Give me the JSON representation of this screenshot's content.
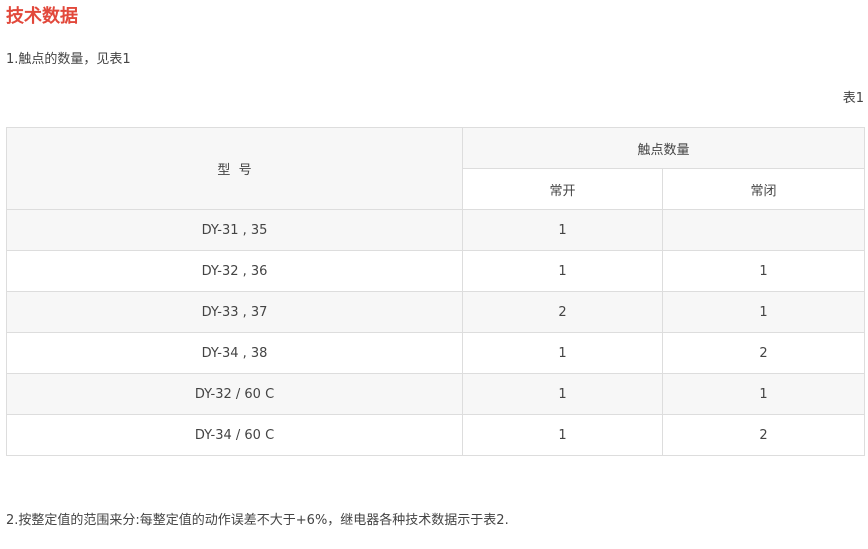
{
  "heading": "技术数据",
  "intro": "1.触点的数量，见表1",
  "table_caption": "表1",
  "table": {
    "header_model": "型  号",
    "header_group": "触点数量",
    "header_no": "常开",
    "header_nc": "常闭",
    "rows": [
      {
        "model": "DY-31 , 35",
        "no": "1",
        "nc": ""
      },
      {
        "model": "DY-32 , 36",
        "no": "1",
        "nc": "1"
      },
      {
        "model": "DY-33 , 37",
        "no": "2",
        "nc": "1"
      },
      {
        "model": "DY-34 , 38",
        "no": "1",
        "nc": "2"
      },
      {
        "model": "DY-32 / 60 C",
        "no": "1",
        "nc": "1"
      },
      {
        "model": "DY-34 / 60 C",
        "no": "1",
        "nc": "2"
      }
    ]
  },
  "footer_note": "2.按整定值的范围来分:每整定值的动作误差不大于+6%，继电器各种技术数据示于表2.",
  "colors": {
    "heading": "#e2483b",
    "stripe": "#f7f7f7",
    "border": "#dddddd"
  }
}
